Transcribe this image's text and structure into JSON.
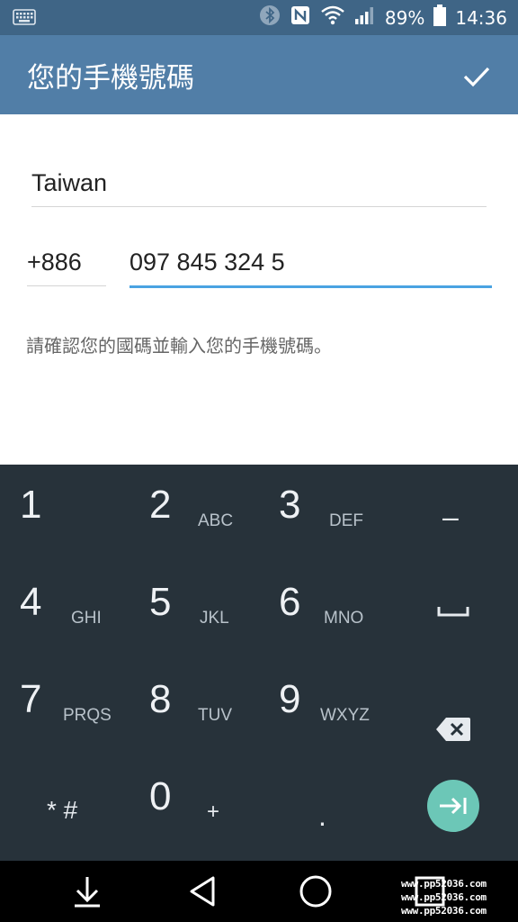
{
  "status_bar": {
    "battery_percent": "89%",
    "time": "14:36",
    "icons": [
      "keyboard-icon",
      "bluetooth-icon",
      "nfc-icon",
      "wifi-icon",
      "signal-icon",
      "battery-icon"
    ]
  },
  "toolbar": {
    "title": "您的手機號碼",
    "done_icon": "check-icon"
  },
  "form": {
    "country": "Taiwan",
    "country_code": "+886",
    "phone_number": "097 845 324 5",
    "hint": "請確認您的國碼並輸入您的手機號碼。"
  },
  "keypad": {
    "keys": [
      {
        "digit": "1",
        "letters": ""
      },
      {
        "digit": "2",
        "letters": "ABC"
      },
      {
        "digit": "3",
        "letters": "DEF"
      },
      {
        "digit": "4",
        "letters": "GHI"
      },
      {
        "digit": "5",
        "letters": "JKL"
      },
      {
        "digit": "6",
        "letters": "MNO"
      },
      {
        "digit": "7",
        "letters": "PRQS"
      },
      {
        "digit": "8",
        "letters": "TUV"
      },
      {
        "digit": "9",
        "letters": "WXYZ"
      },
      {
        "digit": "0",
        "letters": "+"
      }
    ],
    "minus": "–",
    "star_hash": "* #",
    "dot": ".",
    "space_icon": "space-icon",
    "backspace_icon": "backspace-icon",
    "enter_icon": "tab-enter-icon",
    "accent_color": "#6cc7b7"
  },
  "nav_bar": {
    "icons": [
      "hide-keyboard-icon",
      "back-icon",
      "home-icon",
      "recents-icon"
    ]
  },
  "watermark": {
    "lines": [
      "www.pp52036.com",
      "www.pp52036.com",
      "www.pp52036.com"
    ]
  },
  "colors": {
    "status_bar": "#3f6586",
    "toolbar": "#517ea7",
    "keypad": "#27323a",
    "focus_underline": "#4aa3e2"
  }
}
